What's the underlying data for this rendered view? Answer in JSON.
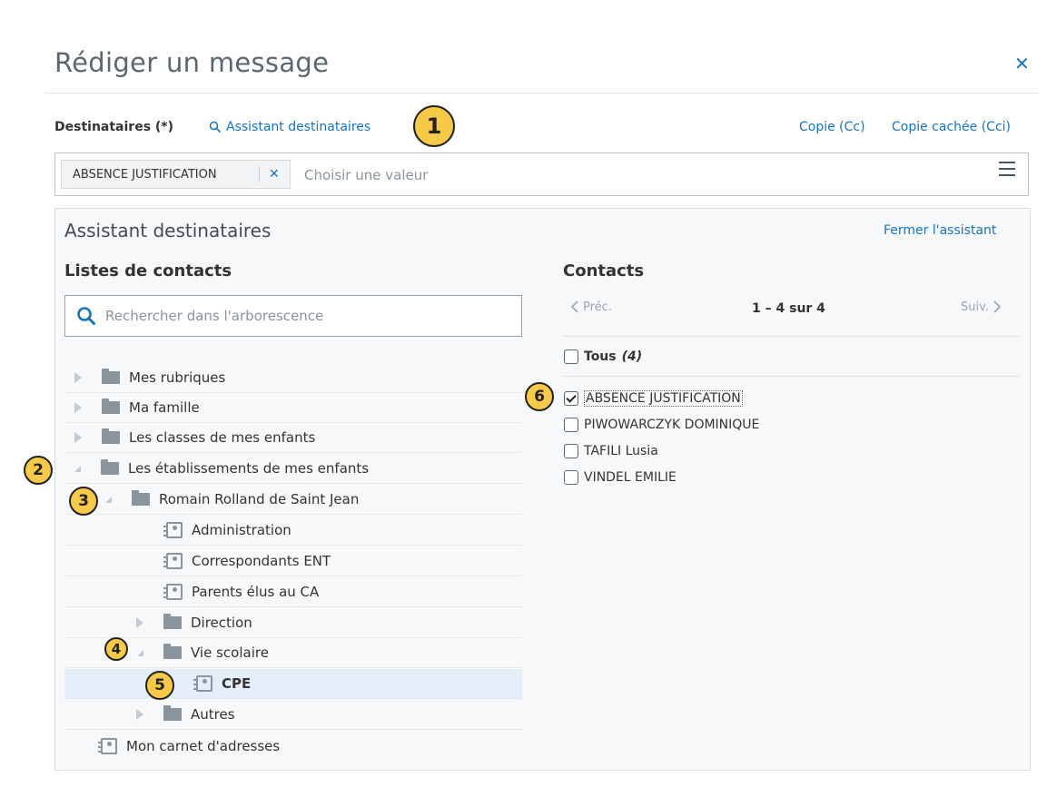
{
  "dialog": {
    "title": "Rédiger un message",
    "close_icon": "close-icon"
  },
  "recipients": {
    "label": "Destinataires (*)",
    "assistant_link": "Assistant destinataires",
    "cc_link": "Copie (Cc)",
    "bcc_link": "Copie cachée (Cci)",
    "chip": "ABSENCE JUSTIFICATION",
    "chip_remove": "✕",
    "placeholder": "Choisir une valeur"
  },
  "assistant": {
    "title": "Assistant destinataires",
    "close_link": "Fermer l'assistant",
    "lists_title": "Listes de contacts",
    "search_placeholder": "Rechercher dans l'arborescence",
    "tree": [
      "Mes rubriques",
      "Ma famille",
      "Les classes de mes enfants",
      "Les établissements de mes enfants",
      "Romain Rolland de Saint Jean",
      "Administration",
      "Correspondants ENT",
      "Parents élus au CA",
      "Direction",
      "Vie scolaire",
      "CPE",
      "Autres",
      "Mon carnet d'adresses"
    ],
    "contacts_title": "Contacts",
    "prev_label": "Préc.",
    "next_label": "Suiv.",
    "paging": "1 – 4 sur 4",
    "select_all_label": "Tous",
    "select_all_count": "(4)",
    "contacts": [
      {
        "name": "ABSENCE JUSTIFICATION",
        "checked": true
      },
      {
        "name": "PIWOWARCZYK DOMINIQUE",
        "checked": false
      },
      {
        "name": "TAFILI Lusia",
        "checked": false
      },
      {
        "name": "VINDEL EMILIE",
        "checked": false
      }
    ]
  },
  "annotations": [
    "1",
    "2",
    "3",
    "4",
    "5",
    "6"
  ],
  "colors": {
    "link": "#1a73b8",
    "selected_row": "#e3eef8",
    "badge": "#f7c948"
  }
}
